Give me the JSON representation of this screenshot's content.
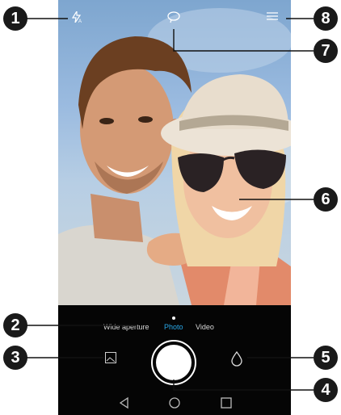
{
  "callouts": [
    "1",
    "2",
    "3",
    "4",
    "5",
    "6",
    "7",
    "8"
  ],
  "camera": {
    "modes": [
      "Wide aperture",
      "Photo",
      "Video"
    ],
    "active_mode": "Photo"
  },
  "icons": {
    "flash": "flash-auto-icon",
    "filter": "filter-loop-icon",
    "menu": "hamburger-menu-icon",
    "gallery": "gallery-thumbnail-icon",
    "beauty": "beauty-drop-icon",
    "back": "nav-back-icon",
    "home": "nav-home-icon",
    "recent": "nav-recent-icon"
  },
  "colors": {
    "active_mode": "#2aa8e8",
    "callout": "#1a1a1a"
  }
}
